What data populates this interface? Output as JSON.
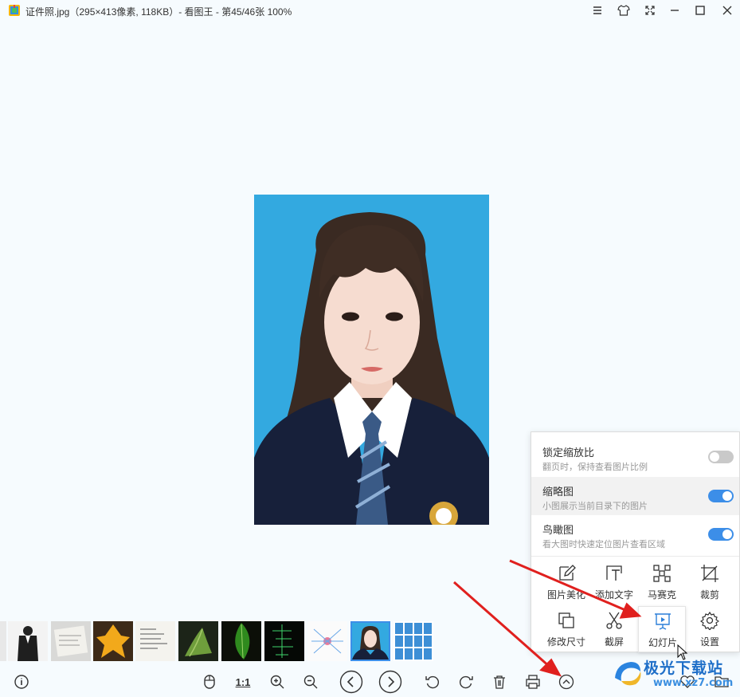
{
  "titlebar": {
    "title": "证件照.jpg（295×413像素, 118KB）- 看图王 - 第45/46张 100%"
  },
  "toolbar": {
    "one_to_one": "1:1"
  },
  "panel": {
    "rows": [
      {
        "title": "锁定缩放比",
        "subtitle": "翻页时，保持查看图片比例",
        "enabled": false
      },
      {
        "title": "缩略图",
        "subtitle": "小图展示当前目录下的图片",
        "enabled": true
      },
      {
        "title": "鸟瞰图",
        "subtitle": "看大图时快速定位图片查看区域",
        "enabled": true
      }
    ],
    "tools": [
      {
        "label": "图片美化",
        "icon": "edit-icon"
      },
      {
        "label": "添加文字",
        "icon": "add-text-icon"
      },
      {
        "label": "马赛克",
        "icon": "mosaic-icon"
      },
      {
        "label": "裁剪",
        "icon": "crop-icon"
      },
      {
        "label": "修改尺寸",
        "icon": "resize-icon"
      },
      {
        "label": "截屏",
        "icon": "scissors-icon"
      },
      {
        "label": "幻灯片",
        "icon": "slideshow-icon"
      },
      {
        "label": "设置",
        "icon": "gear-icon"
      }
    ]
  },
  "watermark": {
    "text": "极光下载站",
    "url": "www.xz7.com"
  },
  "colors": {
    "accent": "#3c8ee8",
    "photo_background": "#33a9e0",
    "arrow": "#e0201e"
  }
}
